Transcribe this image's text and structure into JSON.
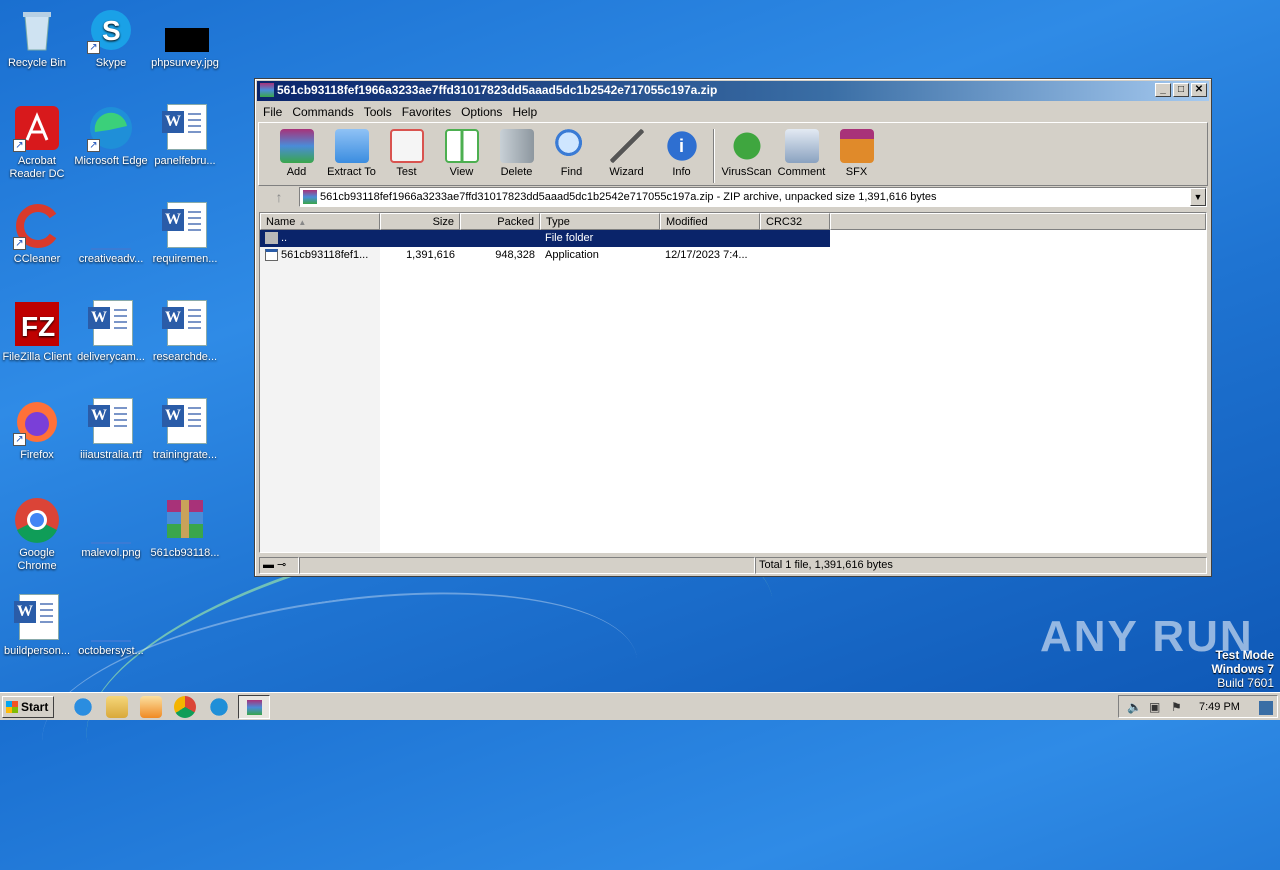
{
  "desktop": {
    "icons": [
      {
        "label": "Recycle Bin",
        "icon": "recycle-bin-icon"
      },
      {
        "label": "Skype",
        "icon": "skype-icon"
      },
      {
        "label": "phpsurvey.jpg",
        "icon": "image-file-icon"
      },
      {
        "label": "Acrobat Reader DC",
        "icon": "acrobat-icon"
      },
      {
        "label": "Microsoft Edge",
        "icon": "edge-icon"
      },
      {
        "label": "panelfebru...",
        "icon": "word-doc-icon"
      },
      {
        "label": "CCleaner",
        "icon": "ccleaner-icon"
      },
      {
        "label": "creativeadv...",
        "icon": "blank-file-icon"
      },
      {
        "label": "requiremen...",
        "icon": "word-doc-icon"
      },
      {
        "label": "FileZilla Client",
        "icon": "filezilla-icon"
      },
      {
        "label": "deliverycam...",
        "icon": "word-doc-icon"
      },
      {
        "label": "researchde...",
        "icon": "word-doc-icon"
      },
      {
        "label": "Firefox",
        "icon": "firefox-icon"
      },
      {
        "label": "iiiaustralia.rtf",
        "icon": "word-doc-icon"
      },
      {
        "label": "trainingrate...",
        "icon": "word-doc-icon"
      },
      {
        "label": "Google Chrome",
        "icon": "chrome-icon"
      },
      {
        "label": "malevol.png",
        "icon": "blank-file-icon"
      },
      {
        "label": "561cb93118...",
        "icon": "winrar-icon"
      },
      {
        "label": "buildperson...",
        "icon": "word-doc-icon"
      },
      {
        "label": "octobersyst...",
        "icon": "blank-file-icon"
      }
    ]
  },
  "window": {
    "title": "561cb93118fef1966a3233ae7ffd31017823dd5aaad5dc1b2542e717055c197a.zip",
    "menu": [
      "File",
      "Commands",
      "Tools",
      "Favorites",
      "Options",
      "Help"
    ],
    "toolbar": [
      {
        "label": "Add",
        "icon": "add-archive-icon",
        "color": "#c0392b"
      },
      {
        "label": "Extract To",
        "icon": "extract-folder-icon",
        "color": "#3b8de0"
      },
      {
        "label": "Test",
        "icon": "test-clipboard-icon",
        "color": "#d9534f"
      },
      {
        "label": "View",
        "icon": "view-book-icon",
        "color": "#4caf50"
      },
      {
        "label": "Delete",
        "icon": "trash-icon",
        "color": "#9aa3ab"
      },
      {
        "label": "Find",
        "icon": "magnifier-icon",
        "color": "#3a7bd5"
      },
      {
        "label": "Wizard",
        "icon": "wand-icon",
        "color": "#7f8c8d"
      },
      {
        "label": "Info",
        "icon": "info-icon",
        "color": "#2e6fd1"
      }
    ],
    "toolbar2": [
      {
        "label": "VirusScan",
        "icon": "virus-scan-icon",
        "color": "#3fa63f"
      },
      {
        "label": "Comment",
        "icon": "comment-icon",
        "color": "#8aa2c0"
      },
      {
        "label": "SFX",
        "icon": "sfx-box-icon",
        "color": "#e08a2a"
      }
    ],
    "address": "561cb93118fef1966a3233ae7ffd31017823dd5aaad5dc1b2542e717055c197a.zip - ZIP archive, unpacked size 1,391,616 bytes",
    "columns": [
      "Name",
      "Size",
      "Packed",
      "Type",
      "Modified",
      "CRC32"
    ],
    "rows": [
      {
        "name": "..",
        "size": "",
        "packed": "",
        "type": "File folder",
        "modified": "",
        "crc": "",
        "selected": true
      },
      {
        "name": "561cb93118fef1...",
        "size": "1,391,616",
        "packed": "948,328",
        "type": "Application",
        "modified": "12/17/2023 7:4...",
        "crc": "",
        "selected": false
      }
    ],
    "status_total": "Total 1 file, 1,391,616 bytes"
  },
  "watermark": {
    "brand": "ANY RUN",
    "mode": "Test Mode",
    "os": "Windows 7",
    "build": "Build 7601"
  },
  "taskbar": {
    "start": "Start",
    "clock": "7:49 PM"
  }
}
